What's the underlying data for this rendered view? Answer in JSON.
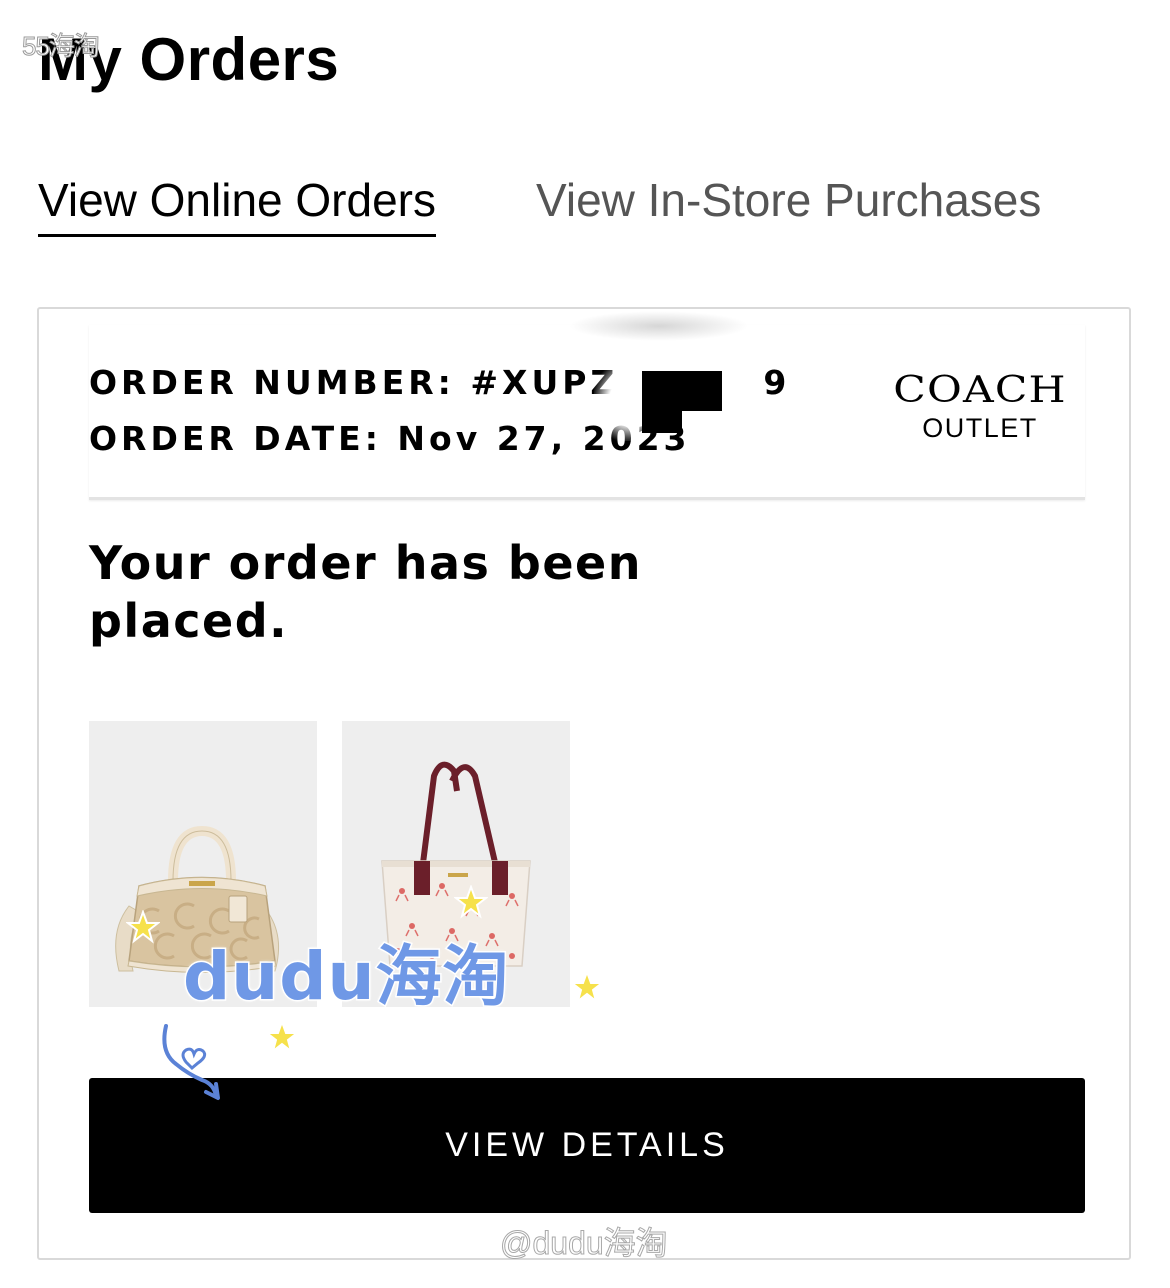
{
  "watermark": {
    "top_left": "55海淘",
    "sticker": "dudu海淘",
    "bottom": "@dudu海淘"
  },
  "page": {
    "title": "My Orders"
  },
  "tabs": [
    {
      "label": "View Online Orders",
      "active": true
    },
    {
      "label": "View In-Store Purchases",
      "active": false
    }
  ],
  "order": {
    "number_label": "ORDER NUMBER:",
    "number_value_visible_start": "#XUPZ",
    "number_value_visible_end": "9",
    "date_label": "ORDER DATE:",
    "date_value": "Nov 27, 2023",
    "status": "Your order has been placed.",
    "brand": {
      "name": "COACH",
      "sub": "OUTLET"
    },
    "items": [
      {
        "icon": "satchel-bag-image",
        "color": "#d9c4a0"
      },
      {
        "icon": "tote-bag-image",
        "color": "#f3ede6"
      }
    ],
    "action_label": "VIEW DETAILS"
  },
  "colors": {
    "tab_active": "#000000",
    "tab_inactive": "#555555",
    "button_bg": "#000000",
    "button_text": "#ffffff",
    "card_border": "#d9d9d9",
    "sticker_blue": "#6f98e6",
    "star_yellow": "#f6e14b"
  }
}
